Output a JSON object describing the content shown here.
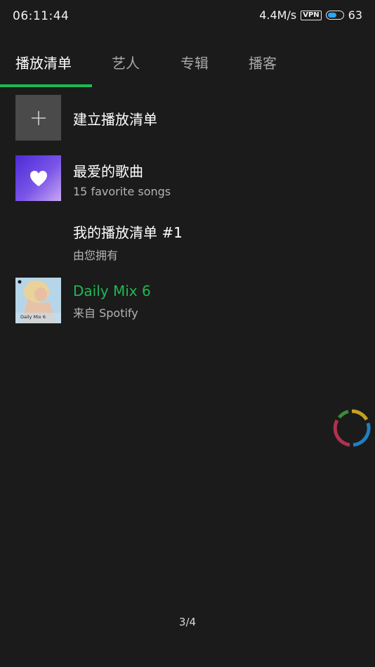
{
  "status_bar": {
    "time": "06:11:44",
    "speed": "4.4M/s",
    "vpn": "VPN",
    "battery": "63",
    "battery_level": 0.63,
    "battery_color": "#2aa6f5"
  },
  "tabs": [
    {
      "label": "播放清单",
      "active": true
    },
    {
      "label": "艺人",
      "active": false
    },
    {
      "label": "专辑",
      "active": false
    },
    {
      "label": "播客",
      "active": false
    }
  ],
  "accent_color": "#1db954",
  "list": [
    {
      "title": "建立播放清单",
      "subtitle": "",
      "icon": "plus-icon"
    },
    {
      "title": "最爱的歌曲",
      "subtitle": "15 favorite songs",
      "icon": "heart-icon"
    },
    {
      "title": "我的播放清单 #1",
      "subtitle": "由您拥有",
      "icon": ""
    },
    {
      "title": "Daily Mix 6",
      "subtitle": "来自 Spotify",
      "cover_label": "Daily Mix 6",
      "title_color": "#1db954"
    }
  ],
  "page_indicator": "3/4",
  "loader_icon": "loading-spinner-icon"
}
